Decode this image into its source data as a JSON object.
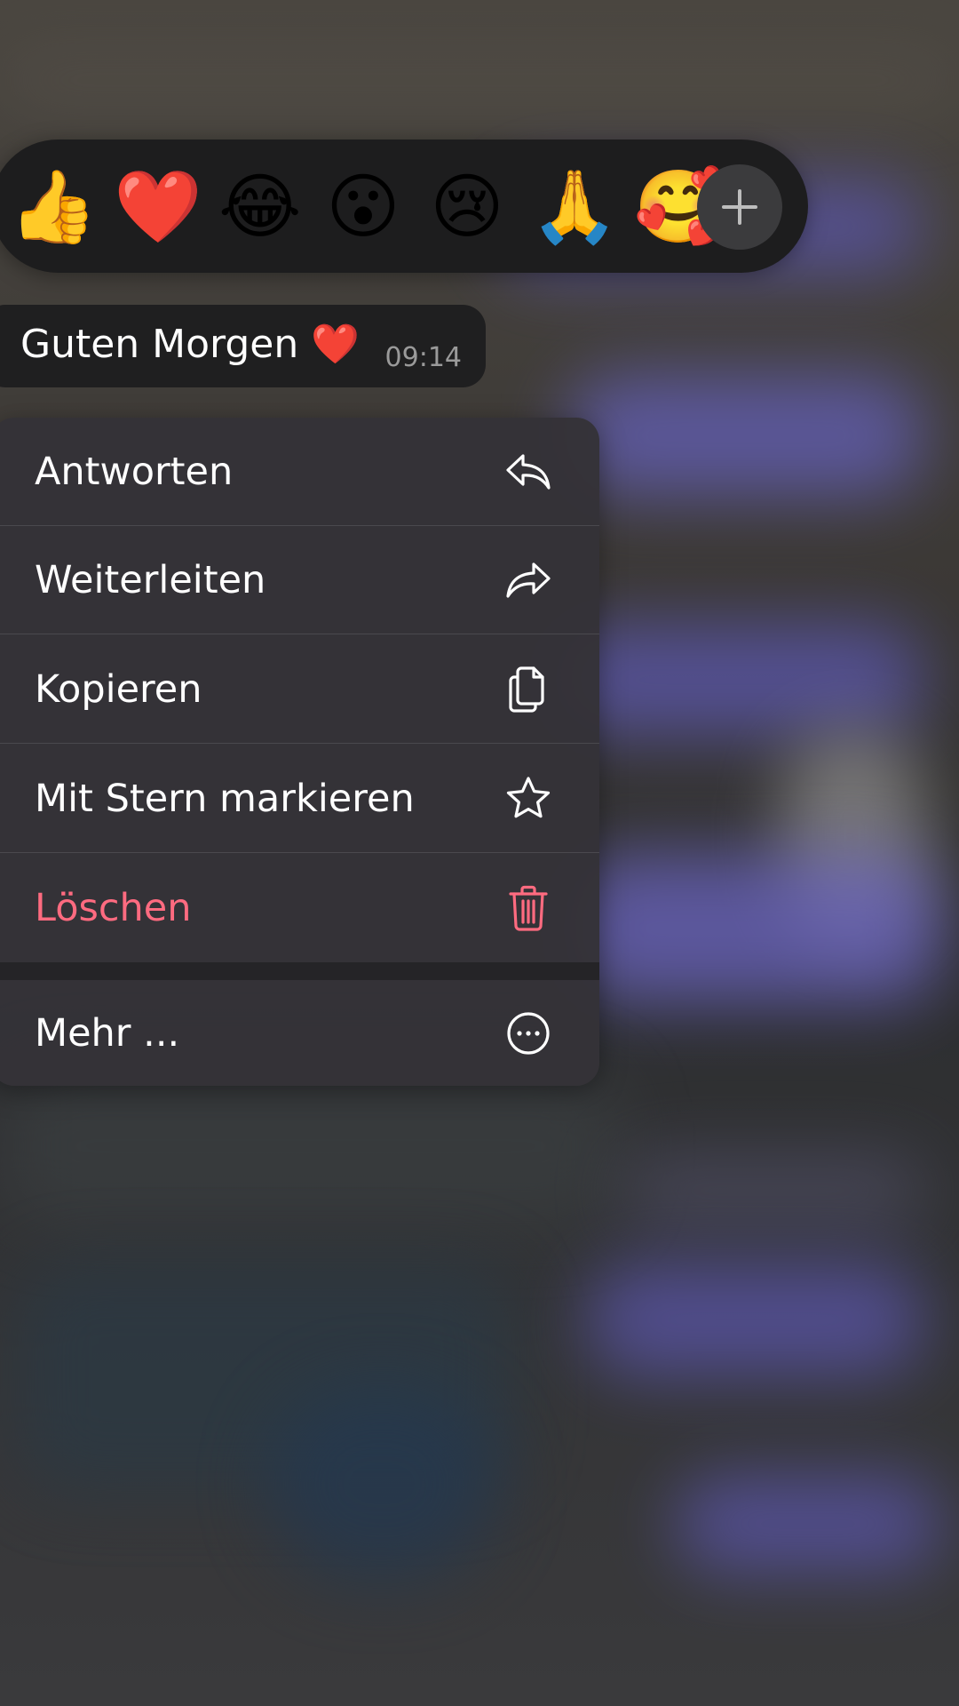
{
  "reactions": {
    "emojis": [
      {
        "name": "thumbs-up",
        "glyph": "👍"
      },
      {
        "name": "red-heart",
        "glyph": "❤️"
      },
      {
        "name": "tears-of-joy",
        "glyph": "😂"
      },
      {
        "name": "surprised",
        "glyph": "😮"
      },
      {
        "name": "crying",
        "glyph": "😢"
      },
      {
        "name": "folded-hands",
        "glyph": "🙏"
      },
      {
        "name": "smiling-face-with-hearts",
        "glyph": "🥰"
      }
    ],
    "more_icon": "plus-icon"
  },
  "message": {
    "text": "Guten Morgen",
    "emoji": "❤️",
    "time": "09:14"
  },
  "menu": {
    "items": [
      {
        "label": "Antworten",
        "icon": "reply-icon"
      },
      {
        "label": "Weiterleiten",
        "icon": "forward-icon"
      },
      {
        "label": "Kopieren",
        "icon": "copy-icon"
      },
      {
        "label": "Mit Stern markieren",
        "icon": "star-icon"
      },
      {
        "label": "Löschen",
        "icon": "trash-icon",
        "color": "#ff6b80"
      },
      {
        "label": "Mehr ...",
        "icon": "more-icon"
      }
    ]
  }
}
